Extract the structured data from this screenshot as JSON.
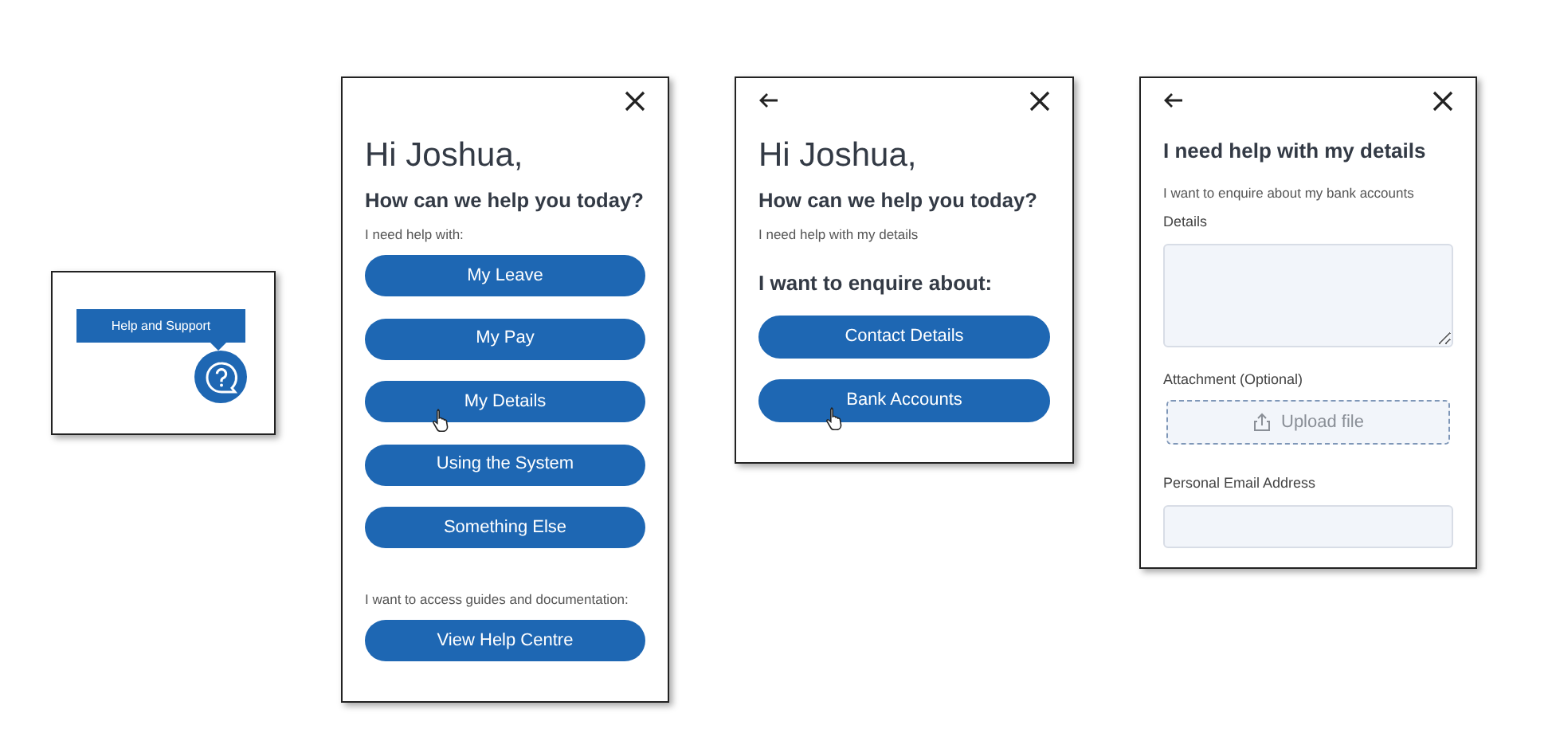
{
  "panels": [
    {
      "kind": "launcher",
      "tooltip": "Help and Support"
    },
    {
      "kind": "dialog",
      "back": false,
      "blocks": [
        {
          "kind": "greeting",
          "text": "Hi Joshua,"
        },
        {
          "kind": "heading",
          "text": "How can we help you today?"
        },
        {
          "kind": "note",
          "text": "I need help with:"
        },
        {
          "kind": "button",
          "text": "My Leave",
          "hovered": false
        },
        {
          "kind": "button",
          "text": "My Pay",
          "hovered": false
        },
        {
          "kind": "button",
          "text": "My Details",
          "hovered": true
        },
        {
          "kind": "button",
          "text": "Using the System",
          "hovered": false
        },
        {
          "kind": "button",
          "text": "Something Else",
          "hovered": false
        },
        {
          "kind": "note",
          "text": "I want to access guides and documentation:"
        },
        {
          "kind": "button",
          "text": "View Help Centre",
          "hovered": false
        }
      ]
    },
    {
      "kind": "dialog",
      "back": true,
      "blocks": [
        {
          "kind": "greeting",
          "text": "Hi Joshua,"
        },
        {
          "kind": "heading",
          "text": "How can we help you today?"
        },
        {
          "kind": "note",
          "text": "I need help with my details"
        },
        {
          "kind": "subheading",
          "text": "I want to enquire about:"
        },
        {
          "kind": "button",
          "text": "Contact Details",
          "hovered": false
        },
        {
          "kind": "button",
          "text": "Bank Accounts",
          "hovered": true
        }
      ]
    },
    {
      "kind": "dialog",
      "back": true,
      "blocks": [
        {
          "kind": "title",
          "text": "I need help with my details"
        },
        {
          "kind": "note",
          "text": "I want to enquire about my bank accounts"
        },
        {
          "kind": "label",
          "text": "Details"
        },
        {
          "kind": "textarea"
        },
        {
          "kind": "label",
          "text": "Attachment (Optional)"
        },
        {
          "kind": "upload",
          "text": "Upload file"
        },
        {
          "kind": "label",
          "text": "Personal Email Address"
        },
        {
          "kind": "input"
        }
      ]
    }
  ]
}
